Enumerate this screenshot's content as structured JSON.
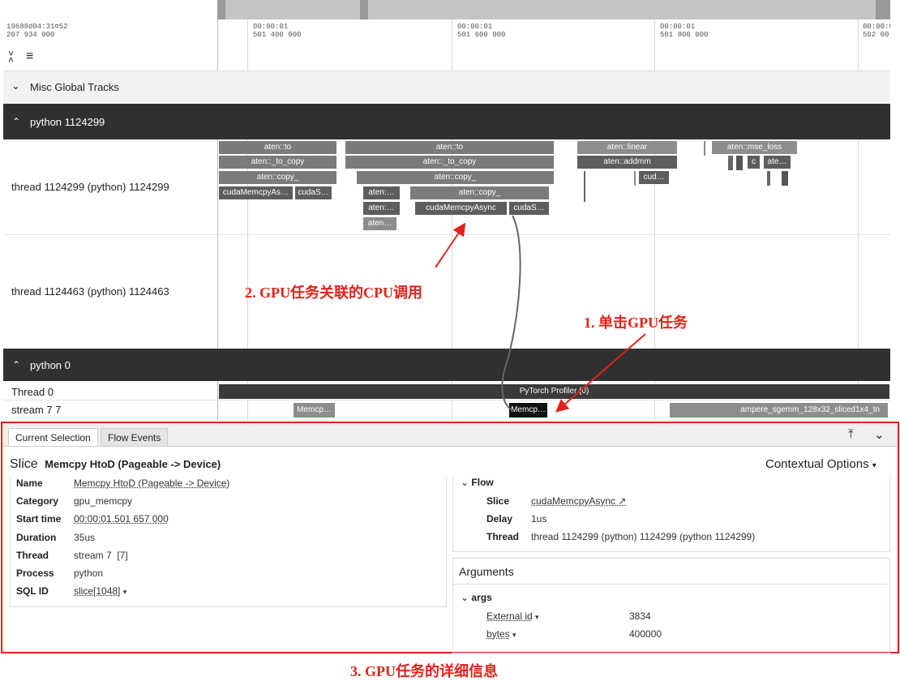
{
  "timeline": {
    "timestamp_line1": "19688d04:31¤52",
    "timestamp_line2": "207 934 000",
    "ticks": [
      {
        "l1": "00:00:01",
        "l2": "501 400 000"
      },
      {
        "l1": "00:00:01",
        "l2": "501 600 000"
      },
      {
        "l1": "00:00:01",
        "l2": "501 800 000"
      },
      {
        "l1": "00:00:0",
        "l2": "502 00"
      }
    ]
  },
  "tracks": {
    "misc_global": "Misc Global Tracks",
    "python_group": "python 1124299",
    "thread_a": "thread 1124299 (python) 1124299",
    "thread_b": "thread 1124463 (python) 1124463",
    "python0_group": "python 0",
    "thread0": "Thread 0",
    "stream": "stream 7 7"
  },
  "slices": {
    "s1": "aten::to",
    "s2": "aten::_to_copy",
    "s3": "aten::copy_",
    "s4": "cudaMemcpyAs…",
    "s5": "cudaS…",
    "s6": "aten::to",
    "s7": "aten::_to_copy",
    "s8": "aten::copy_",
    "s9": "aten:…",
    "s10": "aten::copy_",
    "s11": "aten:…",
    "s12": "cudaMemcpyAsync",
    "s13": "cudaS…",
    "s14": "aten…",
    "s15": "aten::linear",
    "s16": "aten::addmm",
    "s17": "cud…",
    "s18": "aten::mse_loss",
    "s19": "c",
    "s20": "ate…",
    "profiler": "PyTorch Profiler (0)",
    "memcpy1": "Memcp…",
    "memcpy2": "Memcp…",
    "sgemm": "ampere_sgemm_128x32_sliced1x4_tn"
  },
  "annotations": {
    "a1": "1. 单击GPU任务",
    "a2": "2. GPU任务关联的CPU调用",
    "a3": "3. GPU任务的详细信息"
  },
  "panel": {
    "tab_current": "Current Selection",
    "tab_flow": "Flow Events",
    "slice_word": "Slice",
    "slice_title": "Memcpy HtoD (Pageable -> Device)",
    "contextual": "Contextual Options",
    "details": [
      {
        "label": "Name",
        "value": "Memcpy HtoD (Pageable -> Device)"
      },
      {
        "label": "Category",
        "value": "gpu_memcpy"
      },
      {
        "label": "Start time",
        "value": "00:00:01.501 657 000"
      },
      {
        "label": "Duration",
        "value": "35us"
      },
      {
        "label": "Thread",
        "value": "stream 7  [7]"
      },
      {
        "label": "Process",
        "value": "python"
      },
      {
        "label": "SQL ID",
        "value": "slice[1048]"
      }
    ],
    "flow_header": "Flow",
    "flow": [
      {
        "label": "Slice",
        "value": "cudaMemcpyAsync ↗"
      },
      {
        "label": "Delay",
        "value": "1us"
      },
      {
        "label": "Thread",
        "value": "thread 1124299 (python) 1124299 (python 1124299)"
      }
    ],
    "arguments": "Arguments",
    "args_header": "args",
    "args": [
      {
        "key": "External id",
        "value": "3834"
      },
      {
        "key": "bytes",
        "value": "400000"
      }
    ]
  },
  "colors": {
    "annotation": "#e2231a",
    "header_bg": "#303030"
  }
}
